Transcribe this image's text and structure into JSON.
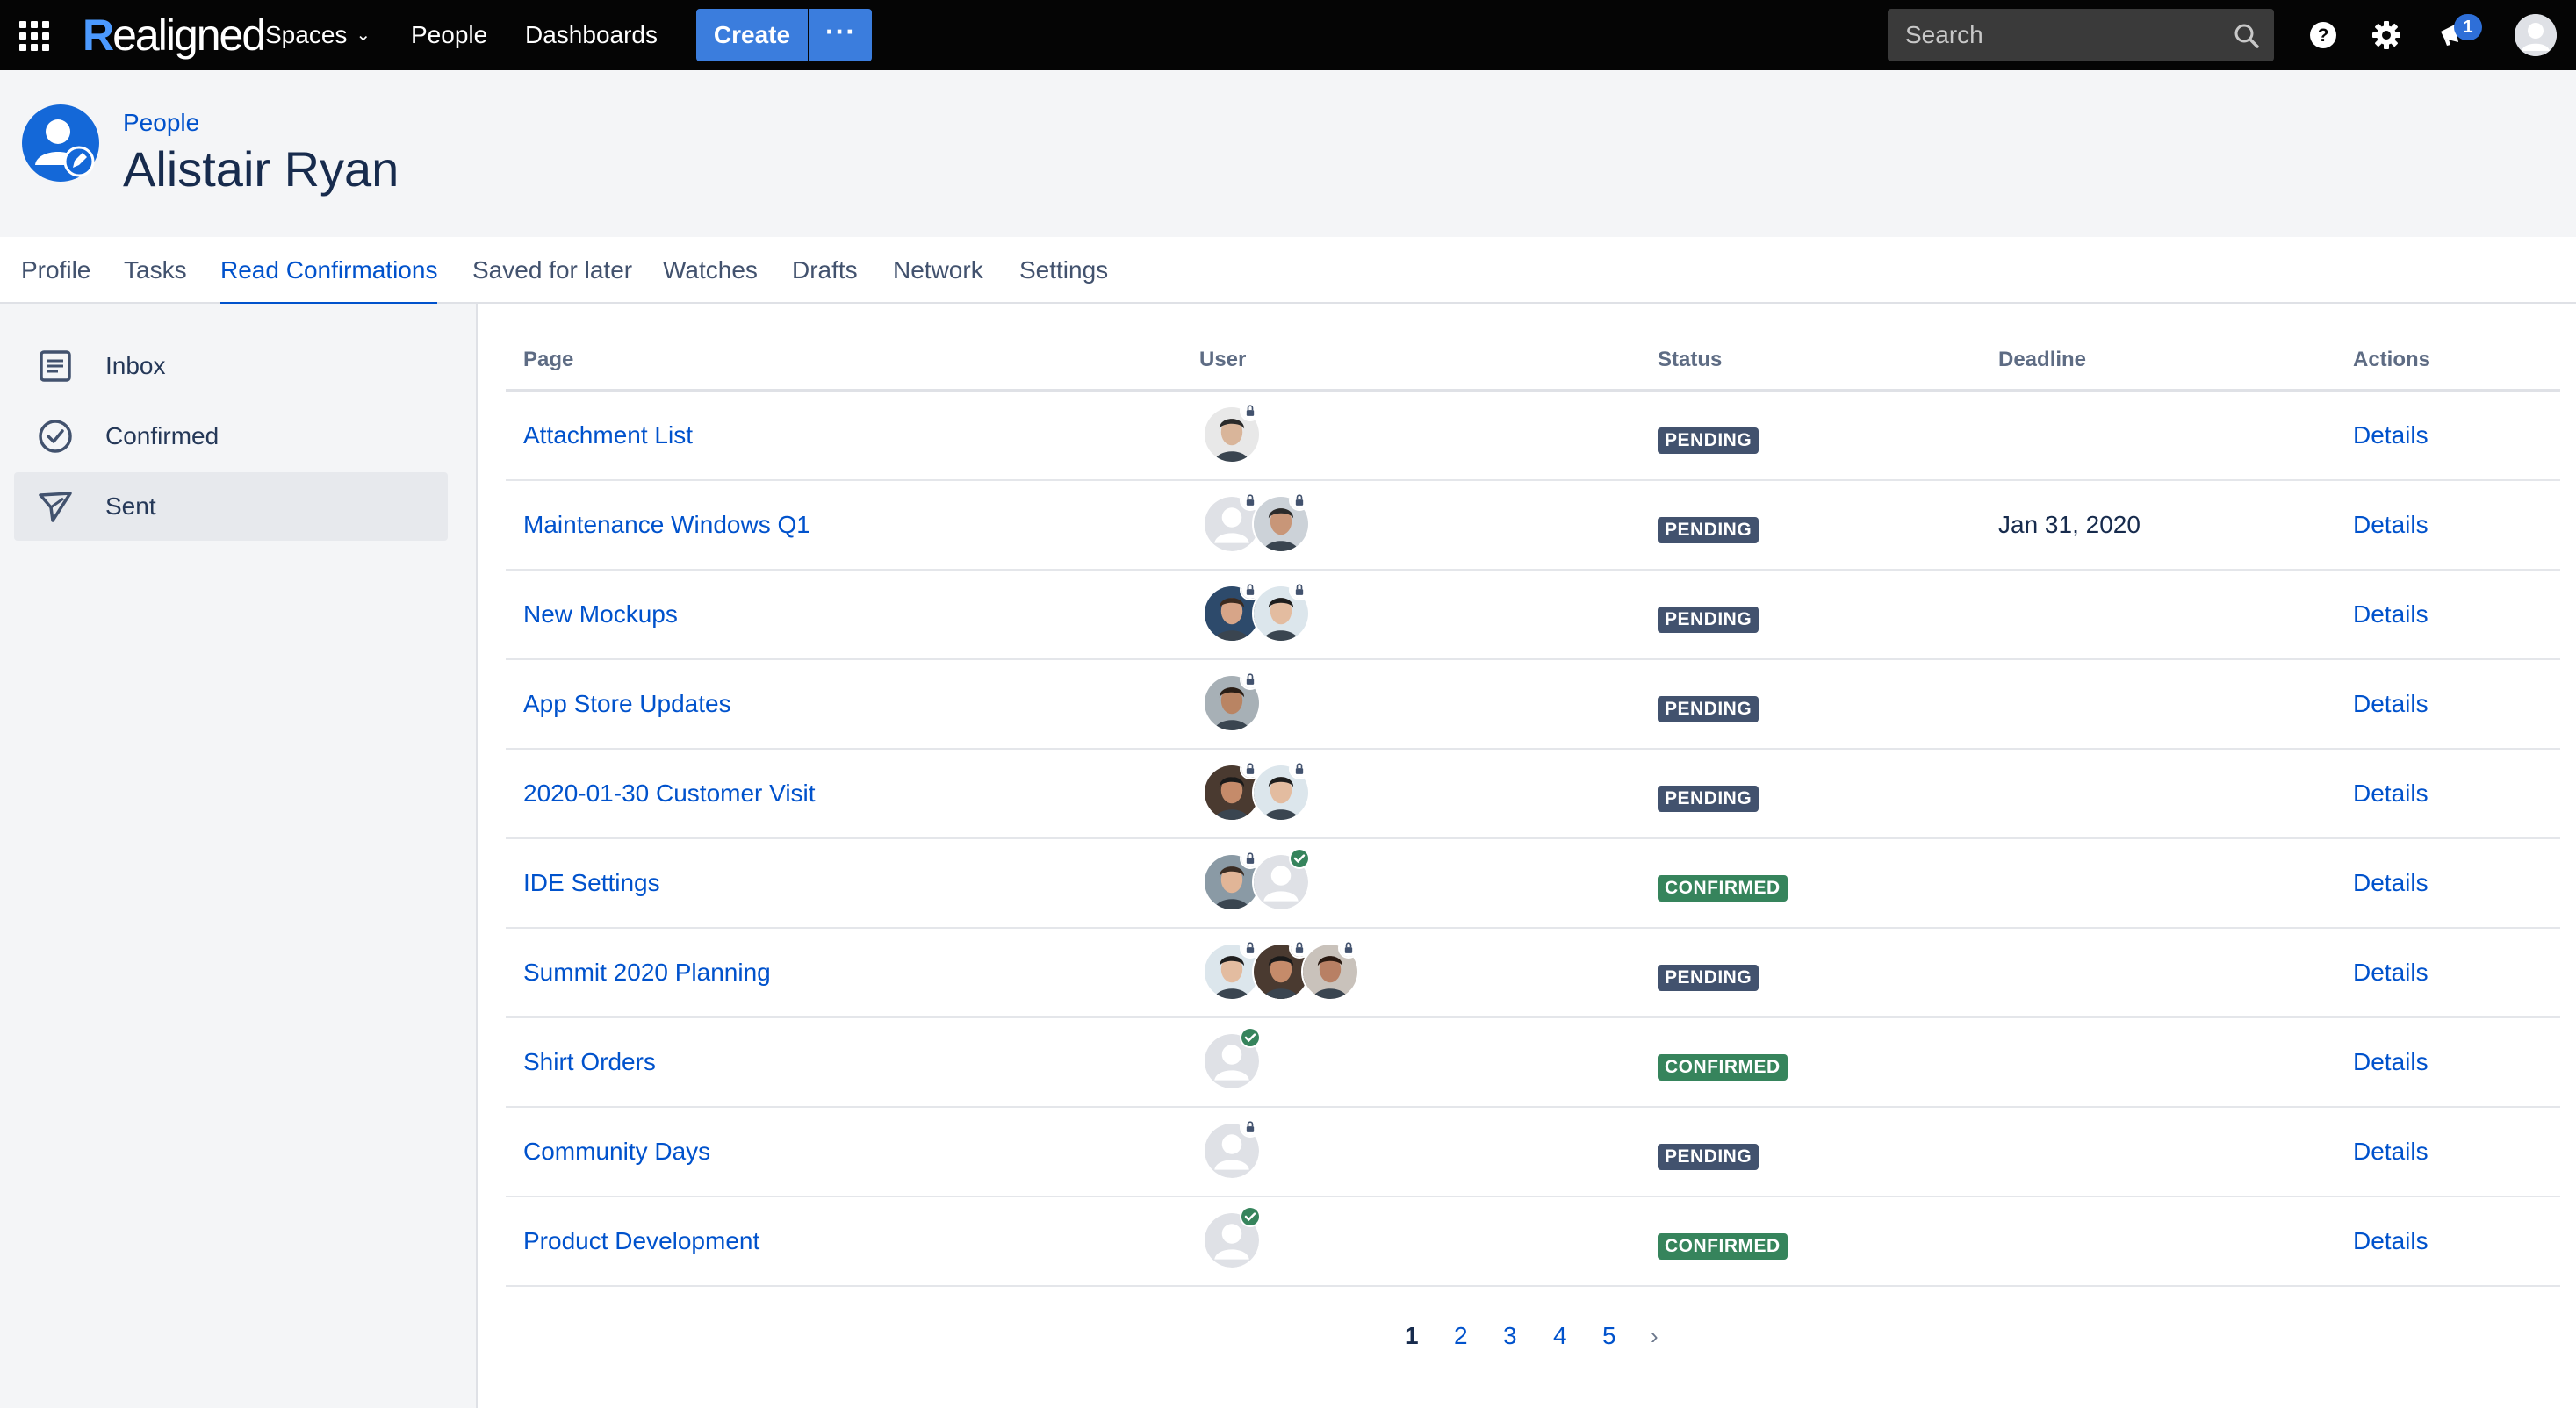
{
  "app": {
    "logo_r": "R",
    "logo_rest": "ealigned",
    "nav": {
      "spaces": "Spaces",
      "people": "People",
      "dashboards": "Dashboards"
    },
    "create_label": "Create",
    "more_label": "···",
    "search_placeholder": "Search",
    "notification_count": "1",
    "accent": "#0052cc"
  },
  "header": {
    "breadcrumb": "People",
    "title": "Alistair Ryan"
  },
  "tabs": [
    {
      "label": "Profile"
    },
    {
      "label": "Tasks"
    },
    {
      "label": "Read Confirmations",
      "active": true
    },
    {
      "label": "Saved for later"
    },
    {
      "label": "Watches"
    },
    {
      "label": "Drafts"
    },
    {
      "label": "Network"
    },
    {
      "label": "Settings"
    }
  ],
  "sidebar": {
    "items": [
      {
        "label": "Inbox",
        "icon": "inbox-icon"
      },
      {
        "label": "Confirmed",
        "icon": "check-circle-icon"
      },
      {
        "label": "Sent",
        "icon": "send-icon",
        "active": true
      }
    ]
  },
  "table": {
    "headers": {
      "page": "Page",
      "user": "User",
      "status": "Status",
      "deadline": "Deadline",
      "actions": "Actions"
    },
    "action_label": "Details",
    "rows": [
      {
        "page": "Attachment List",
        "status": "PENDING",
        "deadline": ""
      },
      {
        "page": "Maintenance Windows Q1",
        "status": "PENDING",
        "deadline": "Jan 31, 2020"
      },
      {
        "page": "New Mockups",
        "status": "PENDING",
        "deadline": ""
      },
      {
        "page": "App Store Updates",
        "status": "PENDING",
        "deadline": ""
      },
      {
        "page": "2020-01-30 Customer Visit",
        "status": "PENDING",
        "deadline": ""
      },
      {
        "page": "IDE Settings",
        "status": "CONFIRMED",
        "deadline": ""
      },
      {
        "page": "Summit 2020 Planning",
        "status": "PENDING",
        "deadline": ""
      },
      {
        "page": "Shirt Orders",
        "status": "CONFIRMED",
        "deadline": ""
      },
      {
        "page": "Community Days",
        "status": "PENDING",
        "deadline": ""
      },
      {
        "page": "Product Development",
        "status": "CONFIRMED",
        "deadline": ""
      }
    ]
  },
  "pagination": {
    "pages": [
      "1",
      "2",
      "3",
      "4",
      "5"
    ],
    "current": "1",
    "next": "›"
  },
  "colors": {
    "pending": "#42526e",
    "confirmed": "#36845c",
    "link": "#0052cc"
  }
}
